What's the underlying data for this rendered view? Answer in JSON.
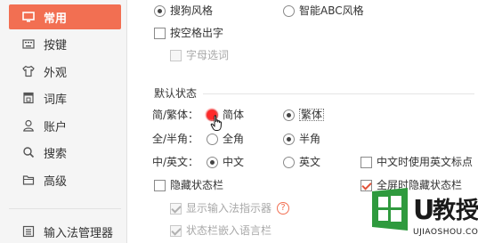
{
  "sidebar": {
    "items": [
      {
        "label": "常用",
        "icon": "monitor-icon",
        "active": true
      },
      {
        "label": "按键",
        "icon": "keyboard-icon"
      },
      {
        "label": "外观",
        "icon": "shirt-icon"
      },
      {
        "label": "词库",
        "icon": "book-icon"
      },
      {
        "label": "账户",
        "icon": "user-icon"
      },
      {
        "label": "搜索",
        "icon": "search-icon"
      },
      {
        "label": "高级",
        "icon": "folder-icon"
      }
    ],
    "bottom_item": {
      "label": "输入法管理器",
      "icon": "list-icon"
    }
  },
  "style_options": {
    "sogou": "搜狗风格",
    "abc": "智能ABC风格",
    "space_output": "按空格出字",
    "letter_select": "字母选词"
  },
  "default_state": {
    "title": "默认状态",
    "simp_trad": {
      "label": "简/繁体：",
      "options": [
        "简体",
        "繁体"
      ],
      "selected": "繁体"
    },
    "full_half": {
      "label": "全/半角：",
      "options": [
        "全角",
        "半角"
      ],
      "selected": "半角"
    },
    "cn_en": {
      "label": "中/英文：",
      "options": [
        "中文",
        "英文"
      ],
      "selected": "中文"
    },
    "use_en_punct": "中文时使用英文标点",
    "hide_status_bar": "隐藏状态栏",
    "fullscreen_hide": "全屏时隐藏状态栏",
    "show_indicator": "显示输入法指示器",
    "embed_lang_bar": "状态栏嵌入语言栏",
    "help_glyph": "?"
  },
  "watermark": {
    "brand_u": "U",
    "brand_text": "教授",
    "url": "UJIAOSHOU.COM"
  },
  "colors": {
    "accent": "#f26f52",
    "sidebar_bg": "#f5f5f5",
    "click_indicator": "#ff2a2a"
  }
}
